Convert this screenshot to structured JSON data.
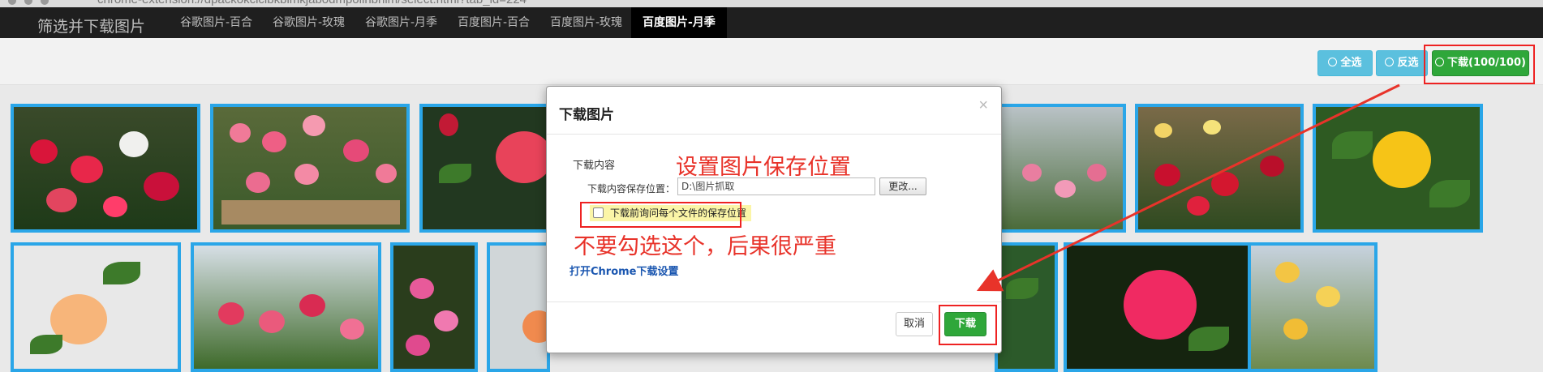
{
  "browser": {
    "url_fragment": "chrome-extension://dpackokcicibkblmkjabodmpolinbnlm/select.html?tab_id=224"
  },
  "navbar": {
    "brand": "筛选并下载图片",
    "tabs": [
      {
        "label": "谷歌图片-百合",
        "active": false
      },
      {
        "label": "谷歌图片-玫瑰",
        "active": false
      },
      {
        "label": "谷歌图片-月季",
        "active": false
      },
      {
        "label": "百度图片-百合",
        "active": false
      },
      {
        "label": "百度图片-玫瑰",
        "active": false
      },
      {
        "label": "百度图片-月季",
        "active": true
      }
    ]
  },
  "toolbar": {
    "select_all_label": "全选",
    "invert_label": "反选",
    "download_label": "下载(100/100)"
  },
  "modal": {
    "title": "下载图片",
    "close_glyph": "×",
    "section_label": "下载内容",
    "path_label": "下载内容保存位置：",
    "path_value": "D:\\图片抓取",
    "change_button": "更改...",
    "ask_each_label": "下载前询问每个文件的保存位置",
    "ask_each_checked": false,
    "open_settings_link": "打开Chrome下载设置",
    "cancel_button": "取消",
    "download_button": "下载"
  },
  "annotations": {
    "set_path": "设置图片保存位置",
    "warning": "不要勾选这个，后果很严重"
  },
  "colors": {
    "thumb_border": "#2aa6e8",
    "annotation_red": "#e8332a",
    "success_green": "#2fa73a",
    "info_blue": "#5bc0de"
  }
}
